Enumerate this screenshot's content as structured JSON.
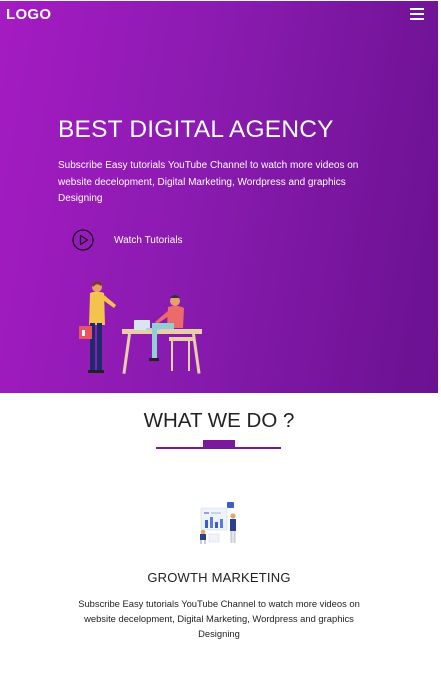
{
  "nav": {
    "logo": "LOGO",
    "menu_icon": "hamburger-menu-icon"
  },
  "hero": {
    "title": "BEST DIGITAL AGENCY",
    "description": "Subscribe Easy tutorials YouTube Channel to watch more videos on website decelopment, Digital Marketing, Wordpress and graphics Designing",
    "watch_label": "Watch Tutorials",
    "play_icon": "play-circle-icon",
    "gradient_start": "#a51bc2",
    "gradient_end": "#6a1190"
  },
  "section": {
    "title": "WHAT WE DO ?",
    "accent_color": "#7a1a9a"
  },
  "service": {
    "title": "GROWTH MARKETING",
    "description": "Subscribe Easy tutorials YouTube Channel to watch more videos on website decelopment, Digital Marketing, Wordpress and graphics Designing"
  }
}
